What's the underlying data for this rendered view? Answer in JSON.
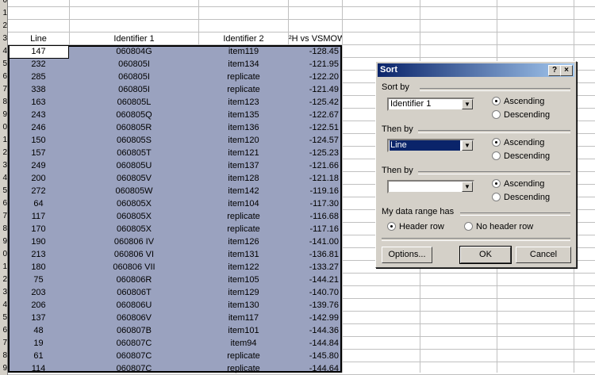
{
  "sheet": {
    "row_numbers": [
      "0",
      "1",
      "2",
      "3",
      "4",
      "5",
      "6",
      "7",
      "8",
      "9",
      "0",
      "1",
      "2",
      "3",
      "4",
      "5",
      "6",
      "7",
      "8",
      "9",
      "0",
      "1",
      "2",
      "3",
      "4",
      "5",
      "6",
      "7",
      "8",
      "9"
    ],
    "headers": {
      "a": "Line",
      "b": "Identifier 1",
      "c": "Identifier 2",
      "d": "²H vs VSMOW"
    },
    "rows": [
      [
        "147",
        "060804G",
        "item119",
        "-128.45"
      ],
      [
        "232",
        "060805I",
        "item134",
        "-121.95"
      ],
      [
        "285",
        "060805I",
        "replicate",
        "-122.20"
      ],
      [
        "338",
        "060805I",
        "replicate",
        "-121.49"
      ],
      [
        "163",
        "060805L",
        "item123",
        "-125.42"
      ],
      [
        "243",
        "060805Q",
        "item135",
        "-122.67"
      ],
      [
        "246",
        "060805R",
        "item136",
        "-122.51"
      ],
      [
        "150",
        "060805S",
        "item120",
        "-124.57"
      ],
      [
        "157",
        "060805T",
        "item121",
        "-125.23"
      ],
      [
        "249",
        "060805U",
        "item137",
        "-121.66"
      ],
      [
        "200",
        "060805V",
        "item128",
        "-121.18"
      ],
      [
        "272",
        "060805W",
        "item142",
        "-119.16"
      ],
      [
        "64",
        "060805X",
        "item104",
        "-117.30"
      ],
      [
        "117",
        "060805X",
        "replicate",
        "-116.68"
      ],
      [
        "170",
        "060805X",
        "replicate",
        "-117.16"
      ],
      [
        "190",
        "060806 IV",
        "item126",
        "-141.00"
      ],
      [
        "213",
        "060806 VI",
        "item131",
        "-136.81"
      ],
      [
        "180",
        "060806 VII",
        "item122",
        "-133.27"
      ],
      [
        "75",
        "060806R",
        "item105",
        "-144.21"
      ],
      [
        "203",
        "060806T",
        "item129",
        "-140.70"
      ],
      [
        "206",
        "060806U",
        "item130",
        "-139.76"
      ],
      [
        "137",
        "060806V",
        "item117",
        "-142.99"
      ],
      [
        "48",
        "060807B",
        "item101",
        "-144.36"
      ],
      [
        "19",
        "060807C",
        "item94",
        "-144.84"
      ],
      [
        "61",
        "060807C",
        "replicate",
        "-145.80"
      ],
      [
        "114",
        "060807C",
        "replicate",
        "-144.64"
      ]
    ]
  },
  "dialog": {
    "title": "Sort",
    "help_btn": "?",
    "close_btn": "×",
    "sort_by_label": "Sort by",
    "sort_by_value": "Identifier 1",
    "then_by1_label": "Then by",
    "then_by1_value": "Line",
    "then_by2_label": "Then by",
    "then_by2_value": "",
    "ascending": "Ascending",
    "descending": "Descending",
    "range_label": "My data range has",
    "header_row": "Header row",
    "no_header_row": "No header row",
    "options_btn": "Options...",
    "ok_btn": "OK",
    "cancel_btn": "Cancel"
  }
}
